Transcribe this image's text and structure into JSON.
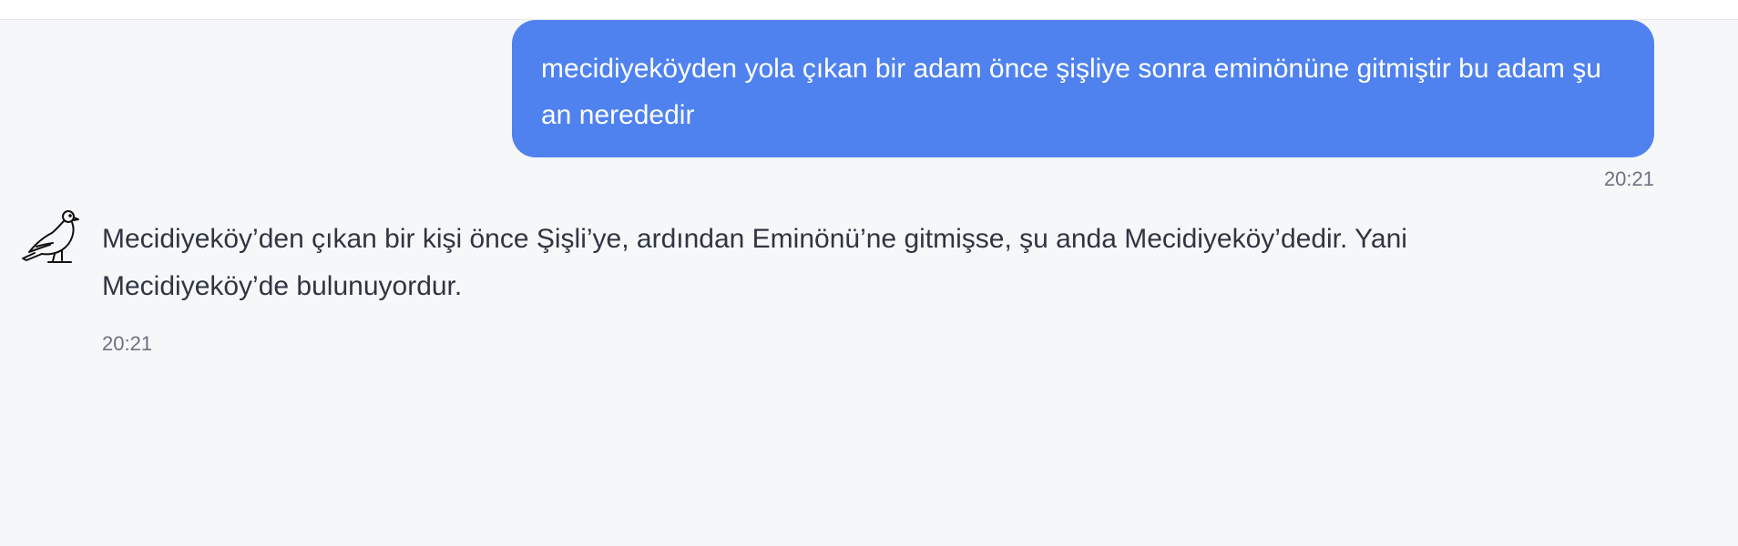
{
  "messages": {
    "user": {
      "text": "mecidiyeköyden yola çıkan bir adam önce şişliye sonra eminönüne gitmiştir bu adam şu an nerededir",
      "time": "20:21",
      "bubble_color": "#4f82ef"
    },
    "assistant": {
      "avatar_icon": "pigeon-icon",
      "text": "Mecidiyeköy’den çıkan bir kişi önce Şişli’ye, ardından Eminönü’ne gitmişse, şu anda Mecidiyeköy’dedir. Yani Mecidiyeköy’de bulunuyordur.",
      "time": "20:21"
    }
  }
}
